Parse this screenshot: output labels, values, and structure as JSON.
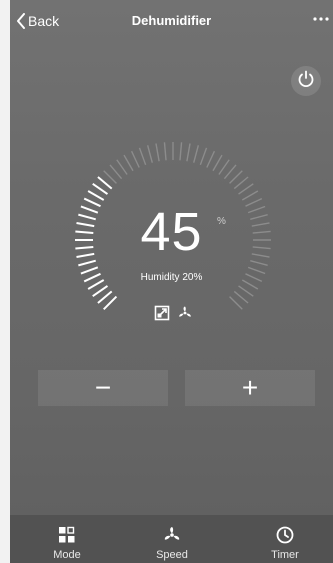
{
  "header": {
    "back_label": "Back",
    "title": "Dehumidifier",
    "more_icon": "ellipsis-icon"
  },
  "power": {
    "icon": "power-icon"
  },
  "dial": {
    "humidity_value": "45",
    "humidity_unit": "%",
    "current_humidity_label": "Humidity 20%",
    "level_fraction": 0.2,
    "mode_indicator_icon": "dehumidify-mode-icon",
    "fan_indicator_icon": "fan-icon"
  },
  "controls": {
    "decrease_label": "−",
    "increase_label": "+"
  },
  "bottom_nav": {
    "items": [
      {
        "label": "Mode",
        "icon": "mode-icon"
      },
      {
        "label": "Speed",
        "icon": "fan-icon"
      },
      {
        "label": "Timer",
        "icon": "clock-icon"
      }
    ]
  },
  "colors": {
    "background": "#6b6b6b",
    "bottom_bar": "#525252",
    "active_tick": "#ffffff",
    "inactive_tick": "#8c8c8c"
  }
}
